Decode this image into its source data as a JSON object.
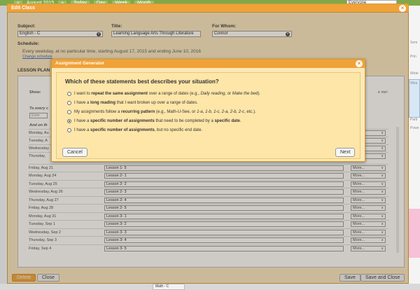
{
  "background": {
    "nav": [
      "«",
      "August 2015",
      "»",
      "Today",
      "Day",
      "Week",
      "Month"
    ],
    "filter": "Everyone",
    "side_labels": [
      "Sem",
      "Prin",
      "Weat",
      "Wea",
      "Parti",
      "Powe"
    ],
    "bottom_cell": "Math - C"
  },
  "edit_class": {
    "title": "Edit Class",
    "subject_label": "Subject:",
    "subject_value": "English - C",
    "title_label": "Title:",
    "title_value": "Learning Language Arts Through Literature",
    "for_whom_label": "For Whom:",
    "for_whom_value": "Connor",
    "schedule_label": "Schedule:",
    "schedule_text": "Every weekday, at no particular time, starting August 17, 2015 and ending June 10, 2016",
    "change_schedule": "Change schedule",
    "lesson_plan_label": "LESSON PLAN",
    "show_label": "Show:",
    "show_hint": "e me!",
    "to_every": "To every c",
    "enter": "Enter",
    "and_on_this": "And on th",
    "rows": [
      {
        "date": "Monday, Au",
        "lesson": "",
        "more": "More..."
      },
      {
        "date": "Tuesday, A",
        "lesson": "",
        "more": "More..."
      },
      {
        "date": "Wednesday",
        "lesson": "",
        "more": "More..."
      },
      {
        "date": "Thursday,",
        "lesson": "",
        "more": "More..."
      },
      {
        "date": "Friday, Aug 21",
        "lesson": "Lesson 1- 5",
        "more": "More..."
      },
      {
        "date": "Monday, Aug 24",
        "lesson": "Lesson 2- 1",
        "more": "More..."
      },
      {
        "date": "Tuesday, Aug 25",
        "lesson": "Lesson 2- 2",
        "more": "More..."
      },
      {
        "date": "Wednesday, Aug 26",
        "lesson": "Lesson 2- 3",
        "more": "More..."
      },
      {
        "date": "Thursday, Aug 27",
        "lesson": "Lesson 2- 4",
        "more": "More..."
      },
      {
        "date": "Friday, Aug 28",
        "lesson": "Lesson 2- 5",
        "more": "More..."
      },
      {
        "date": "Monday, Aug 31",
        "lesson": "Lesson 3- 1",
        "more": "More..."
      },
      {
        "date": "Tuesday, Sep 1",
        "lesson": "Lesson 3- 2",
        "more": "More..."
      },
      {
        "date": "Wednesday, Sep 2",
        "lesson": "Lesson 3- 3",
        "more": "More..."
      },
      {
        "date": "Thursday, Sep 3",
        "lesson": "Lesson 3- 4",
        "more": "More..."
      },
      {
        "date": "Friday, Sep 4",
        "lesson": "Lesson 3- 5",
        "more": "More..."
      }
    ],
    "footer": {
      "delete": "Delete",
      "close": "Close",
      "save": "Save",
      "save_and_close": "Save and Close"
    }
  },
  "generator": {
    "title": "Assignment Generator",
    "question": "Which of these statements best describes your situation?",
    "options": [
      {
        "pre": "I want to ",
        "bold": "repeat the same assignment",
        "post": " over a range of dates (e.g., ",
        "ital": "Daily reading",
        "mid": ", or ",
        "ital2": "Make the bed",
        "end": ").",
        "selected": false
      },
      {
        "pre": "I have a ",
        "bold": "long reading",
        "post": " that I want broken up over a range of dates.",
        "ital": "",
        "mid": "",
        "ital2": "",
        "end": "",
        "selected": false
      },
      {
        "pre": "My assignments follow a ",
        "bold": "recurring pattern",
        "post": " (e.g., Math-U-See, or ",
        "ital": "1-a, 1-b, 1-c, 2-a, 2-b, 2-c",
        "mid": "",
        "ital2": "",
        "end": ", etc.).",
        "selected": false
      },
      {
        "pre": "I have a ",
        "bold": "specific number of assignments",
        "post": " that need to be completed by a ",
        "ital": "",
        "mid": "",
        "ital2": "",
        "end": "",
        "bold2": "specific date",
        "end2": ".",
        "selected": true
      },
      {
        "pre": "I have a ",
        "bold": "specific number of assignments",
        "post": ", but no specific end date.",
        "ital": "",
        "mid": "",
        "ital2": "",
        "end": "",
        "selected": false
      }
    ],
    "cancel": "Cancel",
    "next": "Next"
  },
  "colors": {
    "accent": "#f0a238",
    "panel_bg": "#fbe8c2",
    "modal_bg": "#fde6a8",
    "calendar_green": "#7fa84a"
  }
}
